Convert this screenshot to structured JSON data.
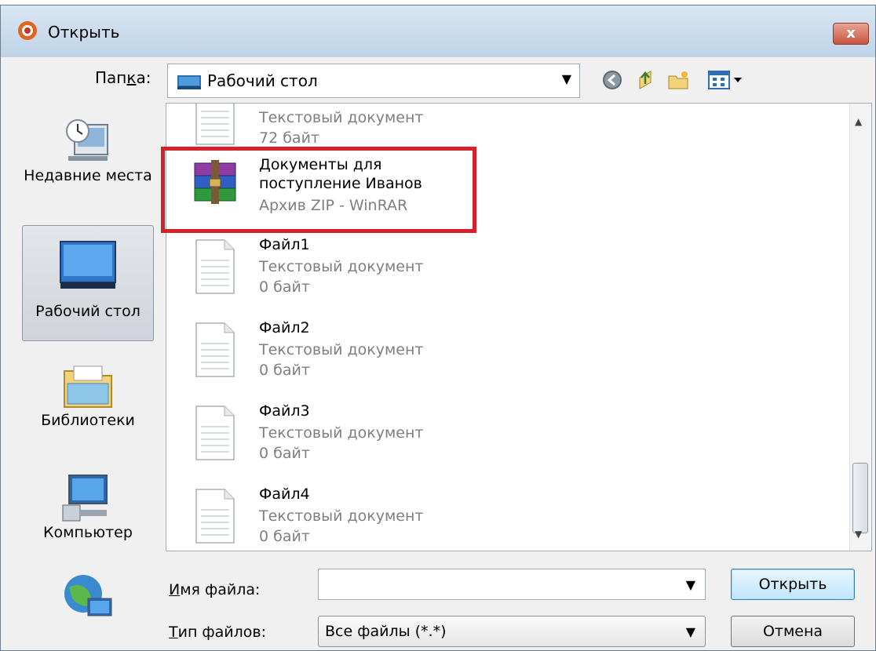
{
  "window": {
    "title": "Открыть",
    "close_label": "x"
  },
  "toolbar": {
    "folder_label_pre": "Пап",
    "folder_label_ul": "к",
    "folder_label_post": "а:",
    "folder_value": "Рабочий стол"
  },
  "places": {
    "recent": "Недавние места",
    "desktop": "Рабочий стол",
    "libraries": "Библиотеки",
    "computer": "Компьютер"
  },
  "files": [
    {
      "name": "",
      "type": "Текстовый документ",
      "size": "72 байт",
      "kind": "text"
    },
    {
      "name": "Документы для поступление Иванов",
      "type": "Архив ZIP - WinRAR",
      "size": "",
      "kind": "archive"
    },
    {
      "name": "Файл1",
      "type": "Текстовый документ",
      "size": "0 байт",
      "kind": "text"
    },
    {
      "name": "Файл2",
      "type": "Текстовый документ",
      "size": "0 байт",
      "kind": "text"
    },
    {
      "name": "Файл3",
      "type": "Текстовый документ",
      "size": "0 байт",
      "kind": "text"
    },
    {
      "name": "Файл4",
      "type": "Текстовый документ",
      "size": "0 байт",
      "kind": "text"
    }
  ],
  "bottom": {
    "filename_label_ul": "И",
    "filename_label_rest": "мя файла:",
    "filename_value": "",
    "filetype_label_ul": "Т",
    "filetype_label_rest": "ип файлов:",
    "filetype_value": "Все файлы (*.*)",
    "open_button": "Открыть",
    "cancel_button": "Отмена"
  },
  "colors": {
    "highlight": "#d6202c",
    "secondary_text": "#7f7f7f"
  }
}
